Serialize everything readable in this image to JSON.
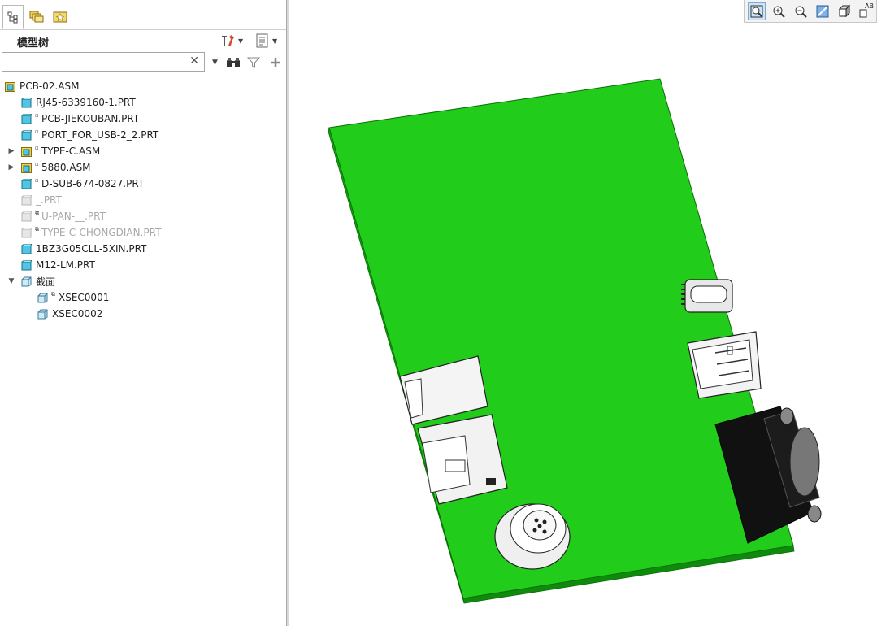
{
  "sidebar": {
    "tabs": [
      {
        "name": "model-tree-tab",
        "icon": "tree-icon",
        "active": true
      },
      {
        "name": "folder-browser-tab",
        "icon": "folder-stack-icon",
        "active": false
      },
      {
        "name": "favorites-tab",
        "icon": "star-folder-icon",
        "active": false
      }
    ],
    "title": "模型树",
    "settings_icon": "tools-icon",
    "show_icon": "list-icon",
    "search": {
      "value": "",
      "placeholder": ""
    },
    "tools": [
      "binoculars-icon",
      "filter-icon",
      "add-icon"
    ]
  },
  "tree": {
    "root": {
      "label": "PCB-02.ASM",
      "icon": "assembly-icon"
    },
    "items": [
      {
        "label": "RJ45-6339160-1.PRT",
        "type": "part",
        "dim": false,
        "expander": "",
        "marker": ""
      },
      {
        "label": "PCB-JIEKOUBAN.PRT",
        "type": "part",
        "dim": false,
        "expander": "",
        "marker": "▫"
      },
      {
        "label": "PORT_FOR_USB-2_2.PRT",
        "type": "part",
        "dim": false,
        "expander": "",
        "marker": "▫"
      },
      {
        "label": "TYPE-C.ASM",
        "type": "assembly",
        "dim": false,
        "expander": "▶",
        "marker": "▫"
      },
      {
        "label": "5880.ASM",
        "type": "assembly",
        "dim": false,
        "expander": "▶",
        "marker": "▫"
      },
      {
        "label": "D-SUB-674-0827.PRT",
        "type": "part",
        "dim": false,
        "expander": "",
        "marker": "▫"
      },
      {
        "label": "_.PRT",
        "type": "part",
        "dim": true,
        "expander": "",
        "marker": ""
      },
      {
        "label": "U-PAN-__.PRT",
        "type": "part",
        "dim": true,
        "expander": "",
        "marker": "⧉"
      },
      {
        "label": "TYPE-C-CHONGDIAN.PRT",
        "type": "part",
        "dim": true,
        "expander": "",
        "marker": "⧉"
      },
      {
        "label": "1BZ3G05CLL-5XIN.PRT",
        "type": "part",
        "dim": false,
        "expander": "",
        "marker": ""
      },
      {
        "label": "M12-LM.PRT",
        "type": "part",
        "dim": false,
        "expander": "",
        "marker": ""
      },
      {
        "label": "截面",
        "type": "folder",
        "dim": false,
        "expander": "▼",
        "marker": ""
      }
    ],
    "sections": [
      {
        "label": "XSEC0001",
        "marker": "⧉"
      },
      {
        "label": "XSEC0002",
        "marker": ""
      }
    ]
  },
  "view_toolbar": {
    "buttons": [
      "refit-icon",
      "zoom-in-icon",
      "zoom-out-icon",
      "repaint-icon",
      "display-style-icon",
      "annotation-display-icon"
    ],
    "annotation_label": "AB"
  },
  "colors": {
    "pcb_green": "#22cc1a",
    "pcb_edge": "#0f7a0c",
    "part_icon": "#4fc6e6",
    "assembly_icon": "#f1d34a",
    "selection_blue": "#cfe3f6"
  }
}
